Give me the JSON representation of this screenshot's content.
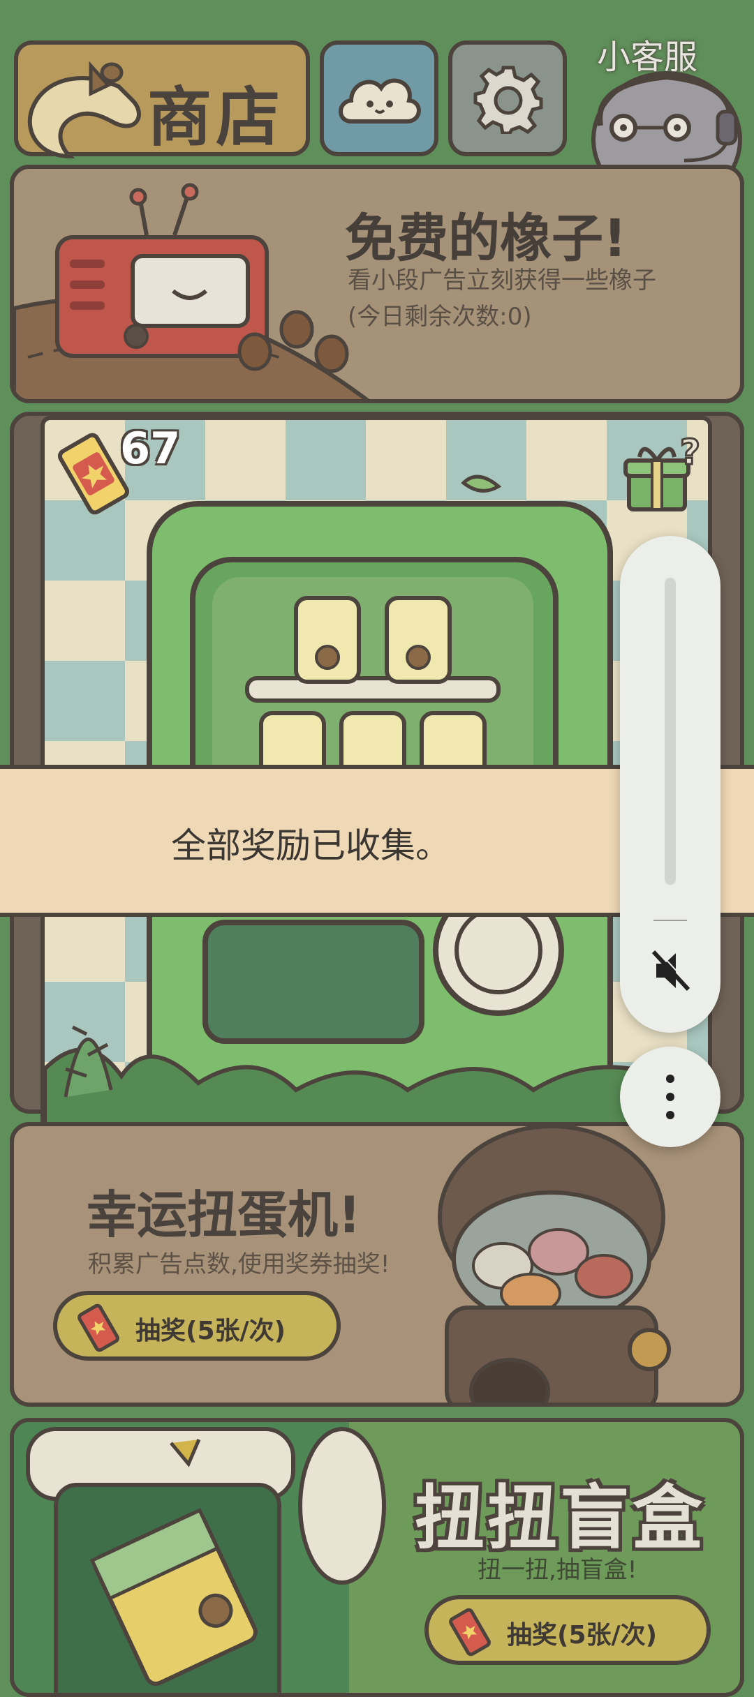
{
  "topbar": {
    "shop_label": "商店",
    "customer_service_label": "小客服"
  },
  "free_acorns": {
    "title": "免费的橡子!",
    "desc_line1": "看小段广告立刻获得一些橡子",
    "desc_line2": "(今日剩余次数:0)"
  },
  "vending": {
    "ticket_count": "67"
  },
  "toast": {
    "message": "全部奖励已收集。"
  },
  "gacha": {
    "title": "幸运扭蛋机!",
    "desc": "积累广告点数,使用奖券抽奖!",
    "button_label": "抽奖(5张/次)"
  },
  "blind_box": {
    "title": "扭扭盲盒",
    "desc": "扭一扭,抽盲盒!",
    "button_label": "抽奖(5张/次)"
  },
  "volume_panel": {
    "mute_icon": "volume-muted-icon",
    "more_icon": "more-vertical-icon"
  },
  "colors": {
    "outline": "#4c433d",
    "background": "#5f8f5a",
    "shop_button": "#b79a5c",
    "cloud_button": "#6f9aa6",
    "toast_bg": "#eed8b6"
  }
}
